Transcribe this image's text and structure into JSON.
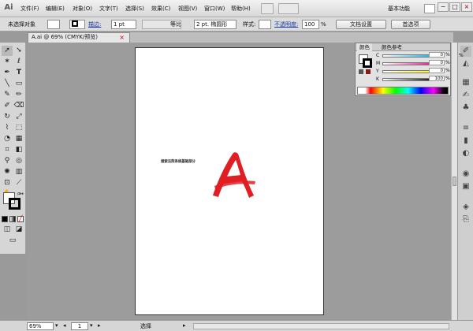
{
  "app": {
    "logo": "Ai"
  },
  "menu": {
    "items": [
      "文件(F)",
      "编辑(E)",
      "对象(O)",
      "文字(T)",
      "选择(S)",
      "效果(C)",
      "视图(V)",
      "窗口(W)",
      "帮助(H)"
    ],
    "workspace": "基本功能"
  },
  "control": {
    "no_selection": "未选择对象",
    "stroke_label": "描边:",
    "stroke_value": "1 pt",
    "stroke_style": "等比",
    "brush": "2 pt. 椭圆形",
    "style_label": "样式:",
    "opacity_label": "不透明度:",
    "opacity_value": "100",
    "opacity_unit": "%",
    "doc_setup": "文档设置",
    "preferences": "首选项"
  },
  "document": {
    "tab": "A.ai @ 69% (CMYK/预览)",
    "close": "×",
    "artboard_text": "搜索法院系统基础部分"
  },
  "color_panel": {
    "tab_color": "颜色",
    "tab_guide": "颜色参考",
    "channels": [
      {
        "label": "C",
        "value": "0",
        "unit": "%"
      },
      {
        "label": "M",
        "value": "0",
        "unit": "%"
      },
      {
        "label": "Y",
        "value": "0",
        "unit": "%"
      },
      {
        "label": "K",
        "value": "100",
        "unit": "%"
      }
    ]
  },
  "status": {
    "zoom": "69%",
    "page": "1",
    "tool": "选择"
  },
  "colors": {
    "accent_red": "#e01f24",
    "ui_gray": "#d6d6d6"
  },
  "icons": [
    "selection-tool-icon",
    "direct-selection-icon",
    "pen-icon",
    "type-icon",
    "line-icon",
    "rectangle-icon",
    "brush-icon",
    "pencil-icon",
    "rotate-icon",
    "scale-icon",
    "warp-icon",
    "free-transform-icon",
    "symbol-sprayer-icon",
    "graph-icon",
    "mesh-icon",
    "gradient-icon",
    "eyedropper-icon",
    "blend-icon",
    "slice-icon",
    "eraser-icon",
    "hand-icon",
    "zoom-icon"
  ]
}
